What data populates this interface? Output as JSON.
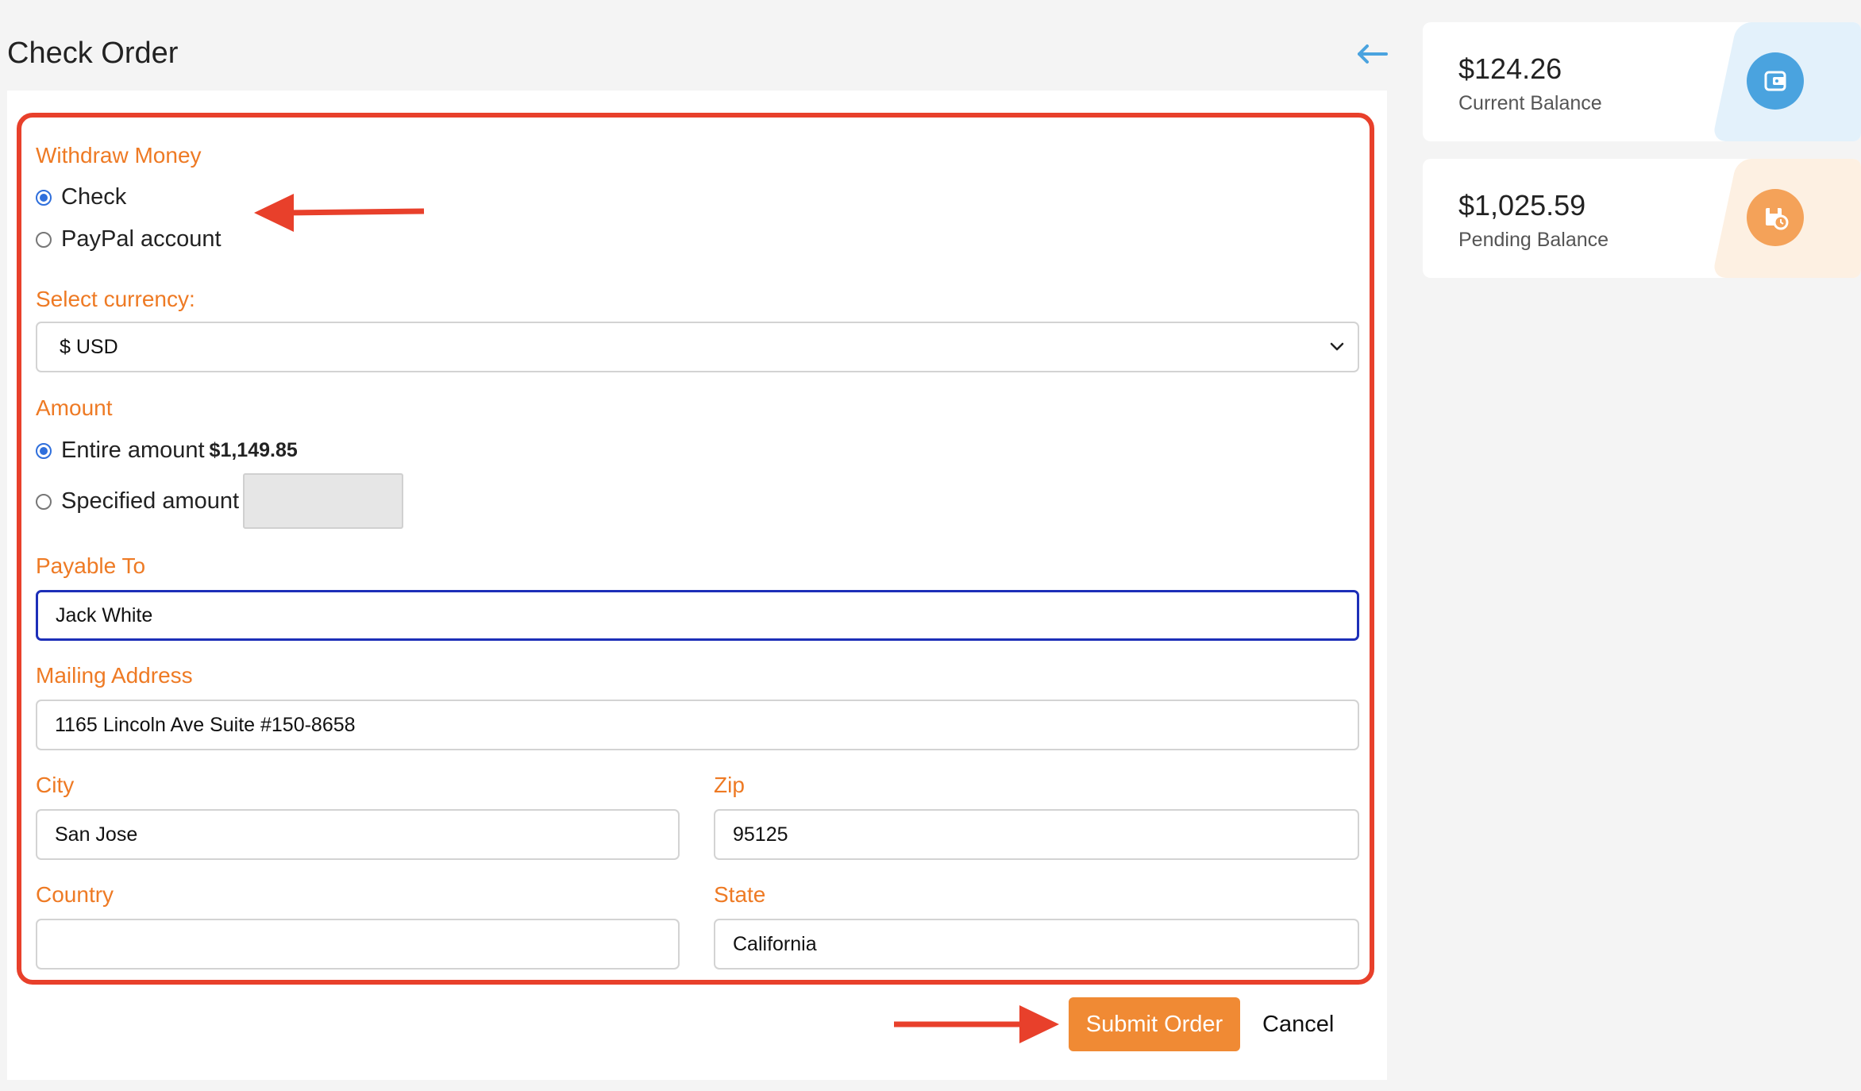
{
  "page": {
    "title": "Check Order"
  },
  "form": {
    "withdraw_label": "Withdraw Money",
    "method_options": [
      {
        "label": "Check",
        "checked": true
      },
      {
        "label": "PayPal account",
        "checked": false
      }
    ],
    "currency_label": "Select currency:",
    "currency_value": "$ USD",
    "amount_label": "Amount",
    "entire_amount_label": "Entire amount",
    "entire_amount_value": "$1,149.85",
    "specified_amount_label": "Specified amount",
    "specified_amount_value": "",
    "payable_label": "Payable To",
    "payable_value": "Jack White",
    "address_label": "Mailing Address",
    "address_value": "1165 Lincoln Ave Suite #150-8658",
    "city_label": "City",
    "city_value": "San Jose",
    "zip_label": "Zip",
    "zip_value": "95125",
    "country_label": "Country",
    "country_value": "",
    "state_label": "State",
    "state_value": "California"
  },
  "actions": {
    "submit_label": "Submit Order",
    "cancel_label": "Cancel"
  },
  "balances": {
    "current": {
      "amount": "$124.26",
      "label": "Current Balance",
      "icon": "wallet-icon",
      "color": "#4aa3df",
      "tint": "#e3f1fb"
    },
    "pending": {
      "amount": "$1,025.59",
      "label": "Pending Balance",
      "icon": "pending-clock-icon",
      "color": "#f4a259",
      "tint": "#fdf0e2"
    }
  },
  "colors": {
    "accent": "#ee7a24",
    "highlight": "#e8402b",
    "focus": "#1d2fb8",
    "back_arrow": "#4aa3df"
  }
}
